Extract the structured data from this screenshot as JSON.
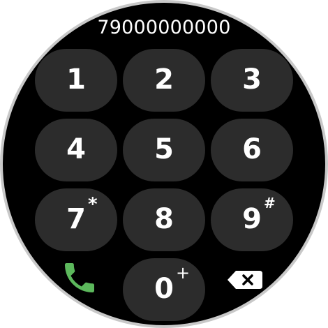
{
  "display": {
    "number": "79000000000"
  },
  "keypad": {
    "k1": {
      "digit": "1"
    },
    "k2": {
      "digit": "2"
    },
    "k3": {
      "digit": "3"
    },
    "k4": {
      "digit": "4"
    },
    "k5": {
      "digit": "5"
    },
    "k6": {
      "digit": "6"
    },
    "k7": {
      "digit": "7",
      "sup": "*"
    },
    "k8": {
      "digit": "8"
    },
    "k9": {
      "digit": "9",
      "sup": "#"
    },
    "k0": {
      "digit": "0",
      "sup": "+"
    }
  },
  "actions": {
    "call_icon": "phone-icon",
    "delete_icon": "backspace-icon"
  },
  "colors": {
    "background": "#000000",
    "key": "#2c2c2c",
    "text": "#ffffff",
    "call": "#5cb85c",
    "bezel": "#c8c8c8"
  }
}
